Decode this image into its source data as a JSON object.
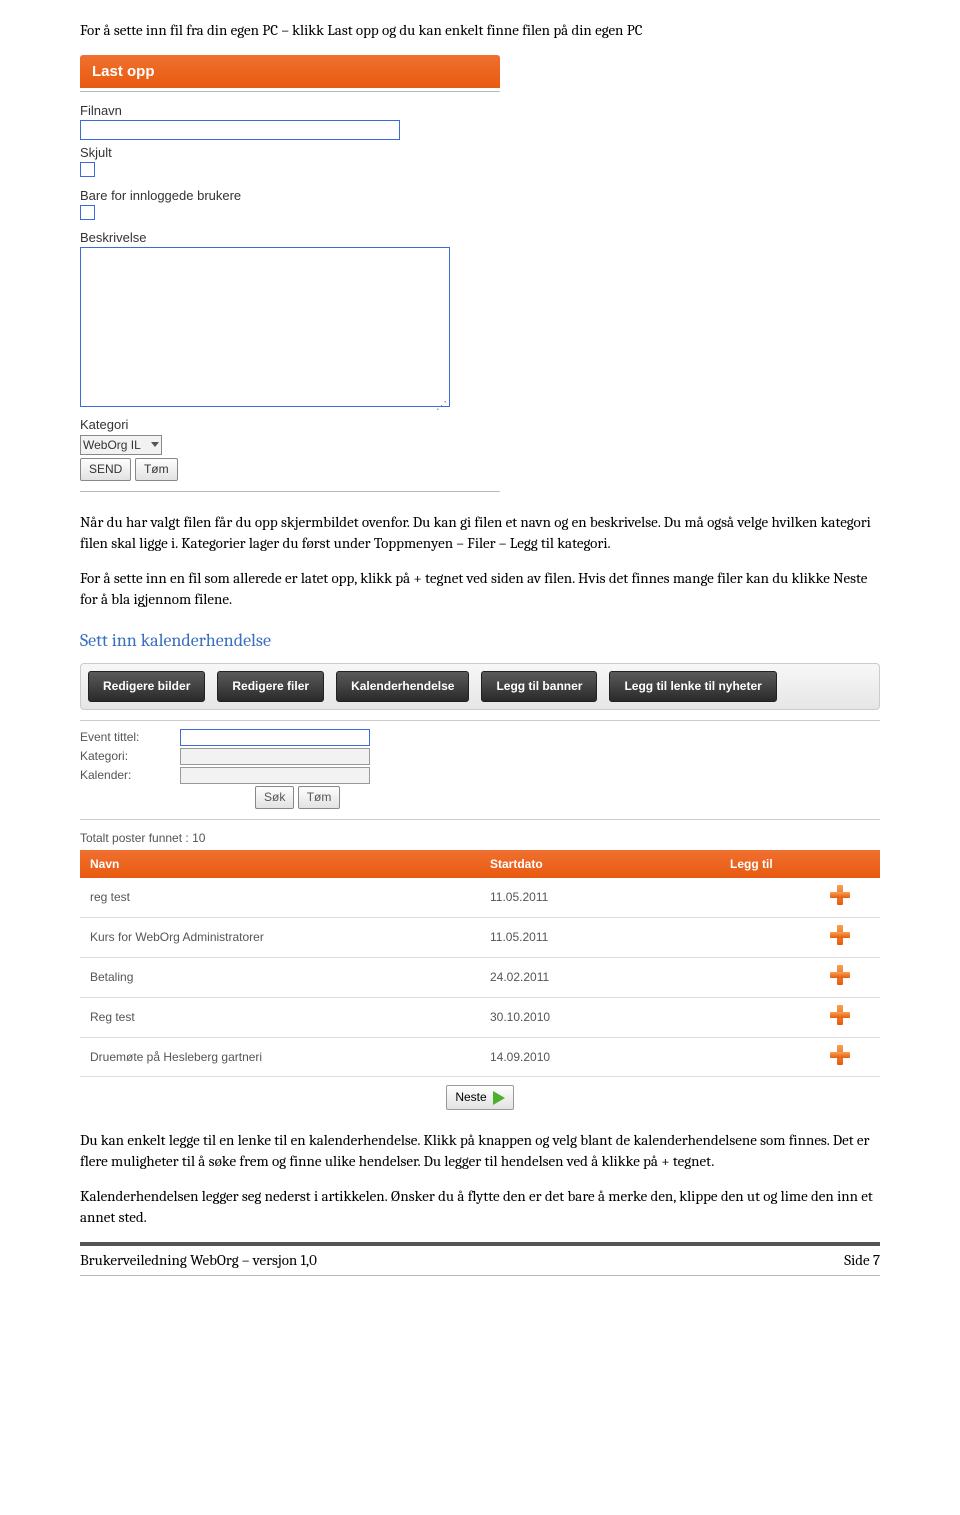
{
  "intro_para": "For å sette inn fil fra din egen PC – klikk Last opp og du kan enkelt finne filen på din egen PC",
  "upload_form": {
    "header": "Last opp",
    "filnavn_label": "Filnavn",
    "filnavn_value": "",
    "skjult_label": "Skjult",
    "bare_label": "Bare for innloggede brukere",
    "beskrivelse_label": "Beskrivelse",
    "beskrivelse_value": "",
    "kategori_label": "Kategori",
    "kategori_value": "WebOrg IL",
    "send_btn": "SEND",
    "tom_btn": "Tøm"
  },
  "mid_para_1": "Når du har valgt filen får du opp skjermbildet ovenfor. Du kan gi filen et navn og en beskrivelse. Du må også velge hvilken kategori filen skal ligge i. Kategorier lager du først under Toppmenyen – Filer – Legg til kategori.",
  "mid_para_2": "For å sette inn en fil som allerede er latet opp, klikk på + tegnet ved siden av filen. Hvis det finnes mange filer kan du klikke Neste for å bla igjennom filene.",
  "section_heading": "Sett inn kalenderhendelse",
  "tabs": [
    "Redigere bilder",
    "Redigere filer",
    "Kalenderhendelse",
    "Legg til banner",
    "Legg til lenke til nyheter"
  ],
  "filter": {
    "event_label": "Event tittel:",
    "kategori_label": "Kategori:",
    "kalender_label": "Kalender:",
    "sok_btn": "Søk",
    "tom_btn": "Tøm"
  },
  "total_posts": "Totalt poster funnet : 10",
  "table": {
    "col_navn": "Navn",
    "col_start": "Startdato",
    "col_legg": "Legg til",
    "rows": [
      {
        "name": "reg test",
        "date": "11.05.2011"
      },
      {
        "name": "Kurs for WebOrg Administratorer",
        "date": "11.05.2011"
      },
      {
        "name": "Betaling",
        "date": "24.02.2011"
      },
      {
        "name": "Reg test",
        "date": "30.10.2010"
      },
      {
        "name": "Druemøte på Hesleberg gartneri",
        "date": "14.09.2010"
      }
    ]
  },
  "neste_btn": "Neste",
  "end_para_1": "Du kan enkelt legge til en lenke til en kalenderhendelse. Klikk på knappen og velg blant de kalenderhendelsene som finnes. Det er flere muligheter til å søke frem og finne ulike hendelser. Du legger til hendelsen ved å klikke på + tegnet.",
  "end_para_2": "Kalenderhendelsen legger seg nederst i artikkelen. Ønsker du å flytte den er det bare å merke den, klippe den ut og lime den inn et annet sted.",
  "footer_left": "Brukerveiledning WebOrg – versjon 1,0",
  "footer_right": "Side 7"
}
